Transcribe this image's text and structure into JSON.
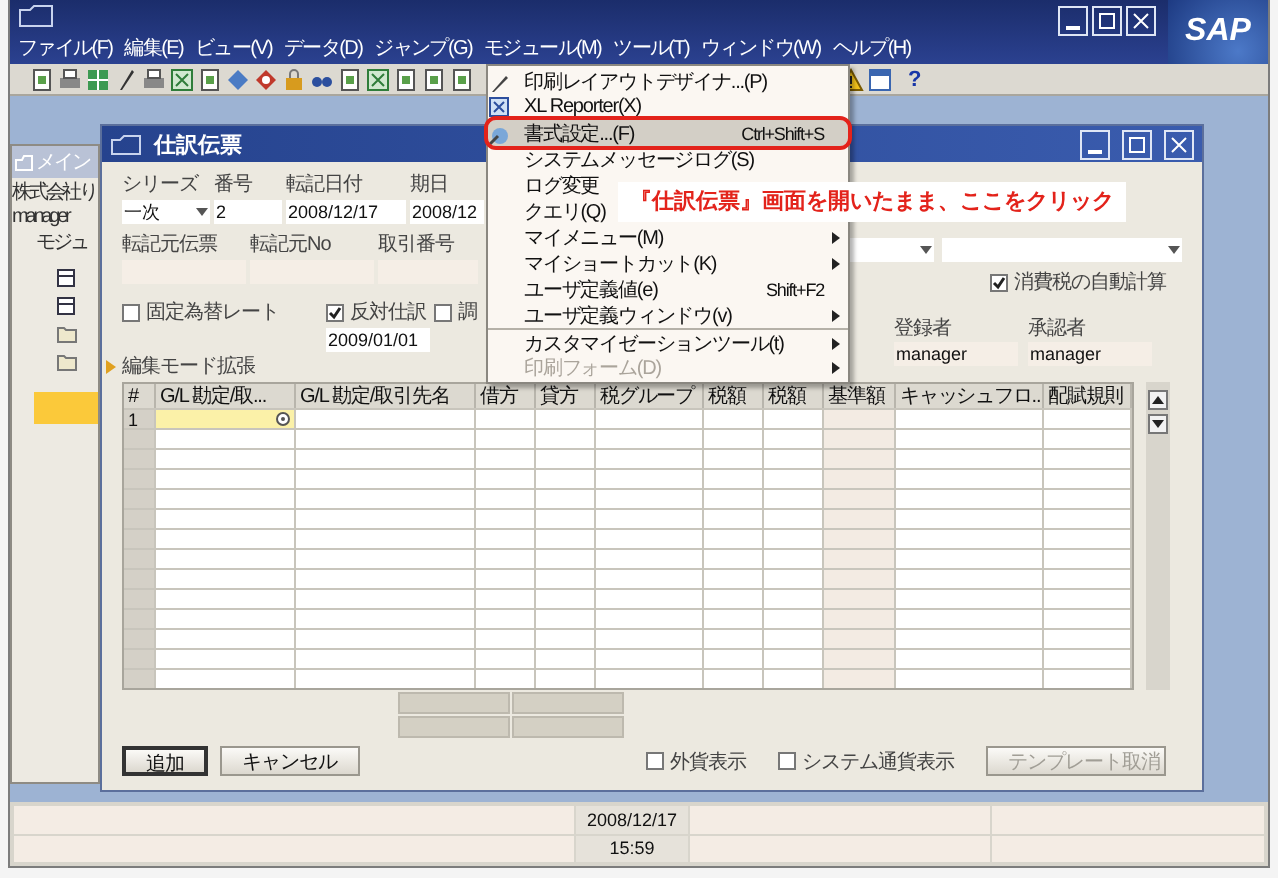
{
  "title_bar": {
    "menus": [
      "ファイル(F)",
      "編集(E)",
      "ビュー(V)",
      "データ(D)",
      "ジャンプ(G)",
      "モジュール(M)",
      "ツール(T)",
      "ウィンドウ(W)",
      "ヘルプ(H)"
    ],
    "logo": "SAP"
  },
  "toolbar": {
    "help": "?"
  },
  "main_menu": {
    "title": "メイン",
    "company": "株式会社り",
    "user": "manager",
    "section": "モジュ"
  },
  "journal": {
    "title": "仕訳伝票",
    "header_labels": [
      "シリーズ",
      "番号",
      "転記日付",
      "期日"
    ],
    "series": "一次",
    "number": "2",
    "posting_date": "2008/12/17",
    "due_date": "2008/12",
    "ref_labels": [
      "転記元伝票",
      "転記元No",
      "取引番号"
    ],
    "options": [
      {
        "label": "固定為替レート",
        "checked": false
      },
      {
        "label": "反対仕訳",
        "checked": true
      },
      {
        "label": "調",
        "checked": false
      }
    ],
    "reverse_date": "2009/01/01",
    "auto_tax": {
      "label": "消費税の自動計算",
      "checked": true
    },
    "people": [
      {
        "label": "登録者",
        "value": "manager"
      },
      {
        "label": "承認者",
        "value": "manager"
      }
    ],
    "expand_label": "編集モード拡張",
    "columns": [
      "#",
      "G/L 勘定/取...",
      "G/L 勘定/取引先名",
      "借方",
      "貸方",
      "税グループ",
      "税額",
      "税額",
      "基準額",
      "キャッシュフロ...",
      "配賦規則"
    ],
    "rows": [
      {
        "number": "1",
        "active": true
      }
    ],
    "buttons": [
      "追加",
      "キャンセル"
    ],
    "display_options": [
      {
        "label": "外貨表示",
        "checked": false
      },
      {
        "label": "システム通貨表示",
        "checked": false
      }
    ],
    "template_button": {
      "label": "テンプレート取消",
      "disabled": true
    }
  },
  "tools_menu": [
    {
      "label": "印刷レイアウトデザイナ...(P)",
      "selected": false,
      "disabled": false,
      "submenu": false,
      "separator_before": false
    },
    {
      "label": "XL Reporter(X)",
      "selected": false,
      "disabled": false,
      "submenu": false,
      "separator_before": false
    },
    {
      "label": "書式設定...(F)",
      "shortcut": "Ctrl+Shift+S",
      "selected": true,
      "disabled": false,
      "submenu": false,
      "separator_before": false
    },
    {
      "label": "システムメッセージログ(S)",
      "selected": false,
      "disabled": false,
      "submenu": false,
      "separator_before": false
    },
    {
      "label": "ログ変更",
      "selected": false,
      "disabled": false,
      "separator_before": false
    },
    {
      "label": "クエリ(Q)",
      "selected": false,
      "disabled": false,
      "separator_before": false
    },
    {
      "label": "マイメニュー(M)",
      "selected": false,
      "disabled": false,
      "submenu": true,
      "separator_before": false
    },
    {
      "label": "マイショートカット(K)",
      "selected": false,
      "disabled": false,
      "submenu": true,
      "separator_before": false
    },
    {
      "label": "ユーザ定義値(e)",
      "shortcut": "Shift+F2",
      "selected": false,
      "disabled": false,
      "submenu": false,
      "separator_before": false
    },
    {
      "label": "ユーザ定義ウィンドウ(v)",
      "selected": false,
      "disabled": false,
      "submenu": true,
      "separator_before": false
    },
    {
      "label": "カスタマイゼーションツール(t)",
      "selected": false,
      "disabled": false,
      "submenu": true,
      "separator_before": true
    },
    {
      "label": "印刷フォーム(D)",
      "selected": false,
      "disabled": true,
      "submenu": true,
      "separator_before": false
    }
  ],
  "callout": "『仕訳伝票』画面を開いたまま、ここをクリック",
  "status_bar": {
    "date": "2008/12/17",
    "time": "15:59"
  }
}
